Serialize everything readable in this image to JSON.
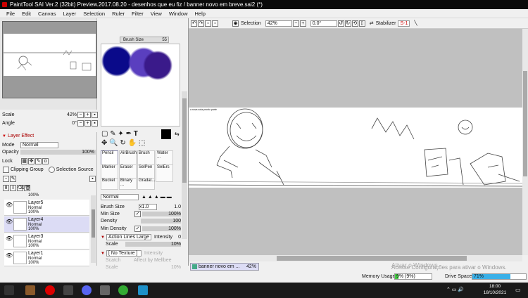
{
  "window": {
    "title": "PaintTool SAI Ver.2 (32bit) Preview.2017.08.20 - desenhos que eu fiz / banner novo em breve.sai2 (*)"
  },
  "menu": [
    "File",
    "Edit",
    "Canvas",
    "Layer",
    "Selection",
    "Ruler",
    "Filter",
    "View",
    "Window",
    "Help"
  ],
  "navigator": {
    "scale_label": "Scale",
    "scale_value": "42%",
    "angle_label": "Angle",
    "angle_value": "0°"
  },
  "layer_panel": {
    "header": "Layer Effect",
    "mode_label": "Mode",
    "mode_value": "Normal",
    "opacity_label": "Opacity",
    "opacity_value": "100%",
    "lock_label": "Lock",
    "clipping_label": "Clipping Group",
    "selection_source_label": "Selection Source",
    "top_partial_opacity": "100%",
    "layers": [
      {
        "name": "Layer5",
        "mode": "Normal",
        "opacity": "100%"
      },
      {
        "name": "Layer4",
        "mode": "Normal",
        "opacity": "100%"
      },
      {
        "name": "Layer3",
        "mode": "Normal",
        "opacity": "100%"
      },
      {
        "name": "Layer1",
        "mode": "Normal",
        "opacity": "100%"
      }
    ]
  },
  "brush_size_label": "Brush Size",
  "brush_size_value": "55",
  "tools": [
    {
      "label": "Pencil"
    },
    {
      "label": "AirBrush"
    },
    {
      "label": "Brush"
    },
    {
      "label": "Water ..."
    },
    {
      "label": "Marker"
    },
    {
      "label": "Eraser"
    },
    {
      "label": "SelPen"
    },
    {
      "label": "SelErs"
    },
    {
      "label": "Bucket"
    },
    {
      "label": "Binary ..."
    },
    {
      "label": "Gradat..."
    }
  ],
  "brush_settings": {
    "blend_mode": "Normal",
    "brush_size_label": "Brush Size",
    "brush_size_mult": "x1.0",
    "brush_size_value": "1.0",
    "min_size_label": "Min Size",
    "min_size_value": "100%",
    "density_label": "Density",
    "density_value": "100",
    "min_density_label": "Min Density",
    "min_density_value": "100%",
    "action_lines": "Action Lines Large",
    "intensity_label": "Intensity",
    "intensity_value": "0",
    "scale_label": "Scale",
    "scale_value": "10%",
    "texture": "[ No Texture ]",
    "texture_intensity_label": "Intensity",
    "texture_scale_label": "Scatch",
    "affect_label": "Affect by Mellbee",
    "texture_scale2_label": "Scale",
    "texture_scale2_value": "10%"
  },
  "canvas_toolbar": {
    "selection_label": "Selection",
    "zoom": "42%",
    "rotation": "0.0°",
    "stabilizer_label": "Stabilizer",
    "stabilizer_value": "S-1"
  },
  "canvas_text": "a nova sota pronto parte",
  "tab": {
    "name": "banner novo em ...",
    "zoom": "42%"
  },
  "status": {
    "memory_label": "Memory Usage",
    "memory_value": "9% (9%)",
    "memory_level": 0.09,
    "drive_label": "Drive Space",
    "drive_value": "71%",
    "drive_level": 0.71
  },
  "watermark": {
    "line1": "Ativar o Windows",
    "line2": "Acesse Configurações para ativar o Windows."
  },
  "taskbar": {
    "time": "18:00",
    "date": "18/10/2021"
  },
  "colors": {
    "accent": "#c00000",
    "selected_layer": "#dcdcf5",
    "swatch1": "#0a0a8a",
    "swatch2": "#5a3fbf",
    "swatch3": "#3a1a8a"
  }
}
